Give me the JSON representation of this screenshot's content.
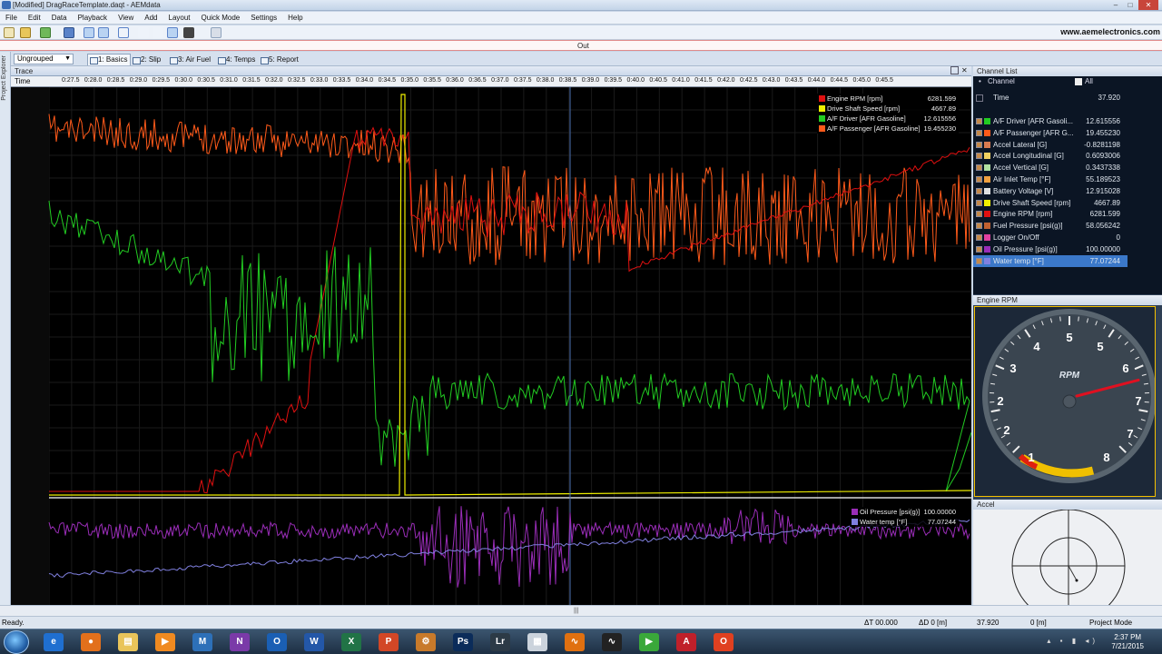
{
  "window": {
    "title": "[Modified] DragRaceTemplate.daqt - AEMdata",
    "minimize": "–",
    "maximize": "□",
    "close": "✕"
  },
  "menu": [
    "File",
    "Edit",
    "Data",
    "Playback",
    "View",
    "Add",
    "Layout",
    "Quick Mode",
    "Settings",
    "Help"
  ],
  "brand": "www.aemelectronics.com",
  "out_label": "Out",
  "explorer_label": "Project Explorer",
  "group_select": "Ungrouped",
  "tabs": [
    "1: Basics",
    "2: Slip",
    "3: Air Fuel",
    "4: Temps",
    "5: Report"
  ],
  "trace": {
    "panel_title": "Trace",
    "time_label": "Time",
    "time_ticks": [
      "0:27.5",
      "0:28.0",
      "0:28.5",
      "0:29.0",
      "0:29.5",
      "0:30.0",
      "0:30.5",
      "0:31.0",
      "0:31.5",
      "0:32.0",
      "0:32.5",
      "0:33.0",
      "0:33.5",
      "0:34.0",
      "0:34.5",
      "0:35.0",
      "0:35.5",
      "0:36.0",
      "0:36.5",
      "0:37.0",
      "0:37.5",
      "0:38.0",
      "0:38.5",
      "0:39.0",
      "0:39.5",
      "0:40.0",
      "0:40.5",
      "0:41.0",
      "0:41.5",
      "0:42.0",
      "0:42.5",
      "0:43.0",
      "0:43.5",
      "0:44.0",
      "0:44.5",
      "0:45.0",
      "0:45.5"
    ],
    "legend_top": [
      {
        "name": "Engine RPM [rpm]",
        "value": "6281.599",
        "color": "#e01010"
      },
      {
        "name": "Drive Shaft Speed [rpm]",
        "value": "4667.89",
        "color": "#f0f000"
      },
      {
        "name": "A/F Driver [AFR Gasoline]",
        "value": "12.615556",
        "color": "#22cc22"
      },
      {
        "name": "A/F Passenger [AFR Gasoline]",
        "value": "19.455230",
        "color": "#ff5a1a"
      }
    ],
    "legend_bottom": [
      {
        "name": "Oil Pressure [psi(g)]",
        "value": "100.00000",
        "color": "#9a2db8"
      },
      {
        "name": "Water temp [°F]",
        "value": "77.07244",
        "color": "#8080e0"
      }
    ]
  },
  "channel_list": {
    "title": "Channel List",
    "col_channel": "Channel",
    "col_all": "All",
    "time_row": {
      "name": "Time",
      "value": "37.920"
    },
    "rows": [
      {
        "name": "A/F Driver [AFR Gasoli...",
        "value": "12.615556",
        "color": "#22cc22"
      },
      {
        "name": "A/F Passenger [AFR G...",
        "value": "19.455230",
        "color": "#ff5a1a"
      },
      {
        "name": "Accel Lateral [G]",
        "value": "-0.8281198",
        "color": "#d87a50"
      },
      {
        "name": "Accel Longitudinal [G]",
        "value": "0.6093006",
        "color": "#f0d060"
      },
      {
        "name": "Accel Vertical [G]",
        "value": "0.3437338",
        "color": "#b0e0a0"
      },
      {
        "name": "Air Inlet Temp [°F]",
        "value": "55.189523",
        "color": "#f0a040"
      },
      {
        "name": "Battery Voltage [V]",
        "value": "12.915028",
        "color": "#e0e0e0"
      },
      {
        "name": "Drive Shaft Speed [rpm]",
        "value": "4667.89",
        "color": "#f0f000"
      },
      {
        "name": "Engine RPM [rpm]",
        "value": "6281.599",
        "color": "#e01010"
      },
      {
        "name": "Fuel Pressure [psi(g)]",
        "value": "58.056242",
        "color": "#c06030"
      },
      {
        "name": "Logger On/Off",
        "value": "0",
        "color": "#e040a0"
      },
      {
        "name": "Oil Pressure [psi(g)]",
        "value": "100.00000",
        "color": "#9a2db8"
      },
      {
        "name": "Water temp [°F]",
        "value": "77.07244",
        "color": "#8080e0",
        "selected": true
      }
    ]
  },
  "gauge": {
    "title": "Engine RPM",
    "label": "RPM",
    "numbers": [
      "1",
      "2",
      "2",
      "3",
      "4",
      "5",
      "5",
      "6",
      "7",
      "7",
      "8"
    ],
    "value_rpm": 6281.599
  },
  "accel_panel": {
    "title": "Accel"
  },
  "status": {
    "ready": "Ready.",
    "delta_t": "ΔT 00.000",
    "delta_d": "ΔD 0 [m]",
    "time": "37.920",
    "dist": "0 [m]",
    "mode": "Project Mode"
  },
  "clock": {
    "time": "2:37 PM",
    "date": "7/21/2015"
  },
  "taskbar_apps": [
    {
      "name": "ie-icon",
      "glyph": "e",
      "color": "#1f6fd0"
    },
    {
      "name": "firefox-icon",
      "glyph": "●",
      "color": "#e2701c"
    },
    {
      "name": "explorer-icon",
      "glyph": "▤",
      "color": "#e9c45a"
    },
    {
      "name": "media-player-icon",
      "glyph": "▶",
      "color": "#f08a20"
    },
    {
      "name": "maps-icon",
      "glyph": "M",
      "color": "#2d70b8"
    },
    {
      "name": "onenote-icon",
      "glyph": "N",
      "color": "#7a3aa8"
    },
    {
      "name": "outlook-icon",
      "glyph": "O",
      "color": "#1a5fb4"
    },
    {
      "name": "word-icon",
      "glyph": "W",
      "color": "#2357a8"
    },
    {
      "name": "excel-icon",
      "glyph": "X",
      "color": "#217346"
    },
    {
      "name": "powerpoint-icon",
      "glyph": "P",
      "color": "#d24726"
    },
    {
      "name": "folder-icon",
      "glyph": "⚙",
      "color": "#c87a2a"
    },
    {
      "name": "photoshop-icon",
      "glyph": "Ps",
      "color": "#0b2c5a"
    },
    {
      "name": "lightroom-icon",
      "glyph": "Lr",
      "color": "#2c3a46"
    },
    {
      "name": "network-icon",
      "glyph": "▦",
      "color": "#cbd3dc"
    },
    {
      "name": "graph-icon",
      "glyph": "∿",
      "color": "#e07010"
    },
    {
      "name": "aemdata-icon",
      "glyph": "∿",
      "color": "#222"
    },
    {
      "name": "play-icon",
      "glyph": "▶",
      "color": "#3aa83a"
    },
    {
      "name": "acrobat-icon",
      "glyph": "A",
      "color": "#c0202a"
    },
    {
      "name": "office-icon",
      "glyph": "O",
      "color": "#e04020"
    }
  ],
  "colors": {
    "rpm": "#e01010",
    "shaft": "#f0f000",
    "afr_driver": "#22cc22",
    "afr_pass": "#ff5a1a",
    "oil": "#9a2db8",
    "water": "#8080e0",
    "gauge_border": "#f4c000",
    "selection": "#3b78c9"
  }
}
